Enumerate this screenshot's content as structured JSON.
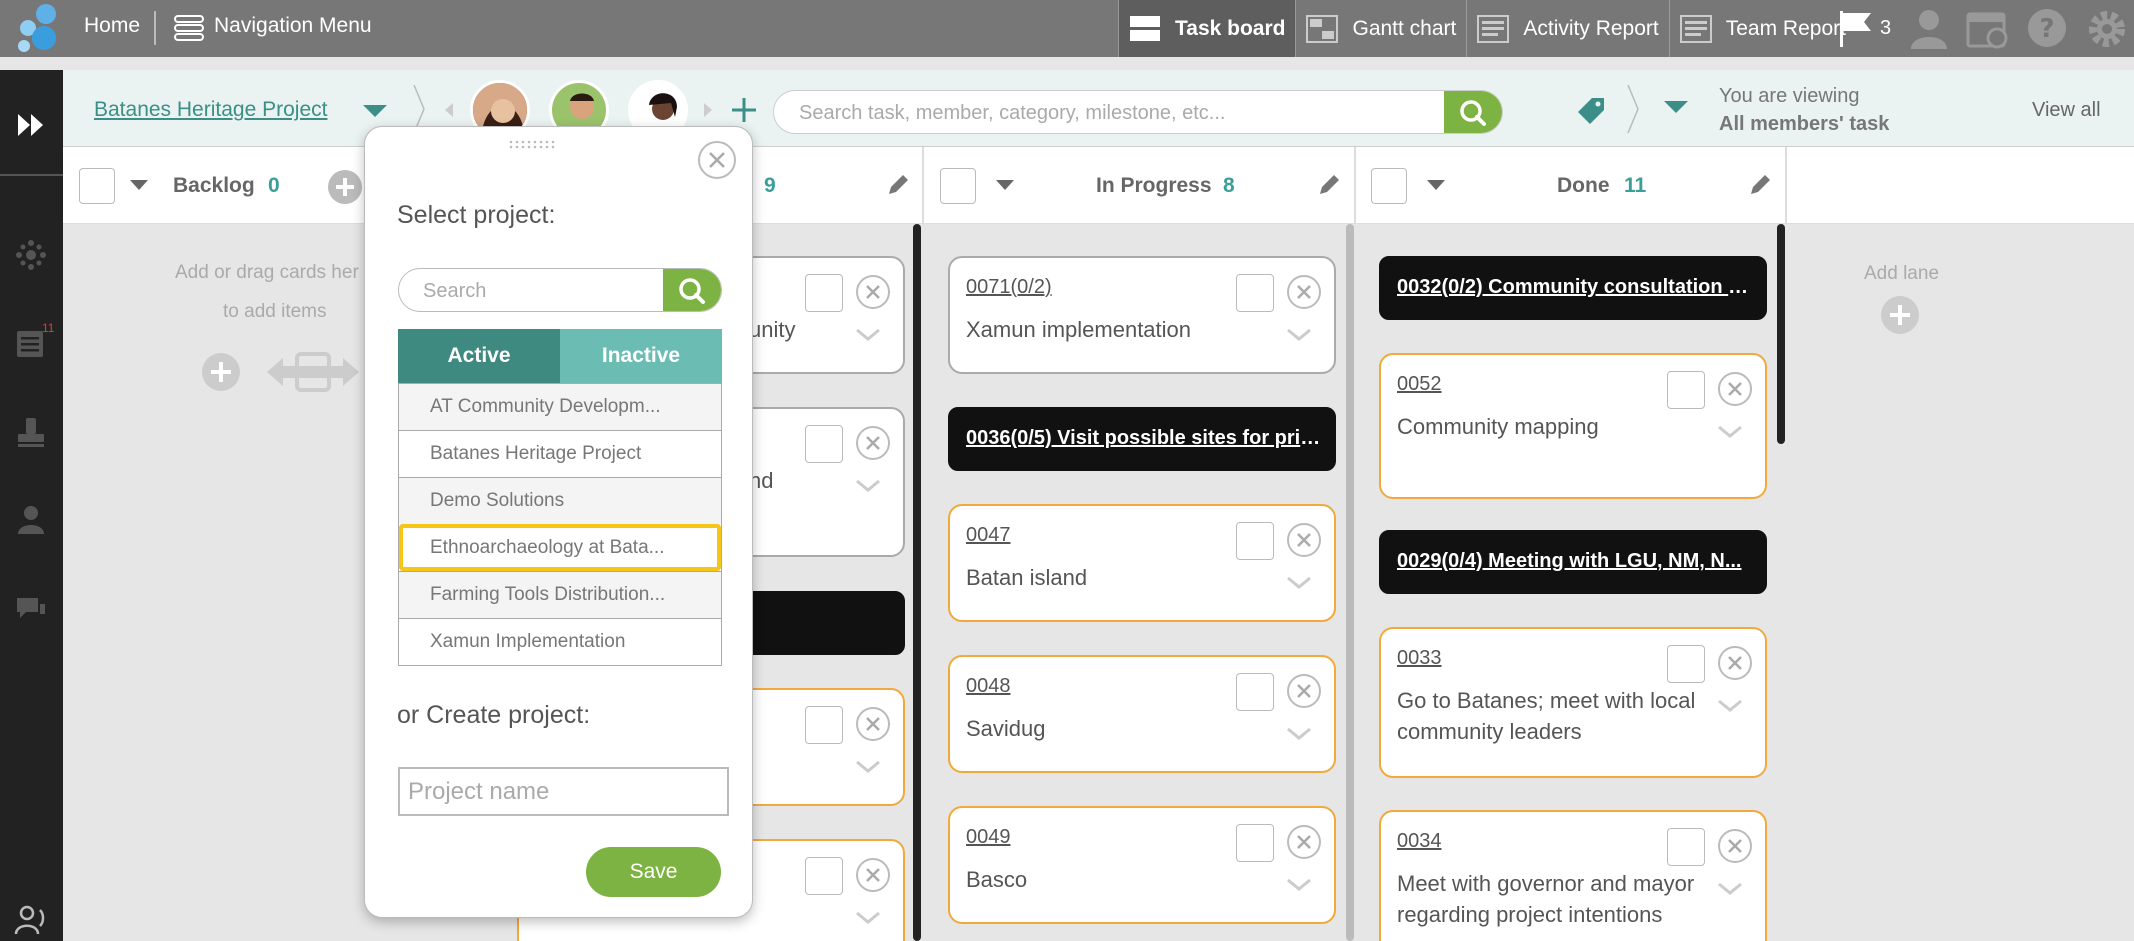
{
  "topbar": {
    "home": "Home",
    "nav_menu": "Navigation Menu",
    "tabs": [
      {
        "label": "Task board",
        "icon": "task-board-icon",
        "active": true
      },
      {
        "label": "Gantt chart",
        "icon": "gantt-chart-icon",
        "active": false
      },
      {
        "label": "Activity Report",
        "icon": "activity-report-icon",
        "active": false
      },
      {
        "label": "Team Report",
        "icon": "team-report-icon",
        "active": false
      }
    ],
    "flag_count": "3"
  },
  "sidebar": {
    "icons": [
      "expand-icon",
      "dashboard-icon",
      "tasks-icon",
      "stamp-icon",
      "user-icon",
      "chat-icon",
      "help-user-icon"
    ],
    "tasks_badge": "11"
  },
  "project_bar": {
    "project_name": "Batanes Heritage Project",
    "search_placeholder": "Search task, member, category, milestone, etc...",
    "viewing_line1": "You are viewing",
    "viewing_line2": "All members' task",
    "view_all": "View all"
  },
  "lanes": [
    {
      "title": "Backlog",
      "count": "0",
      "empty_text_1": "Add or drag cards her",
      "empty_text_2": "to add items"
    },
    {
      "title": "",
      "count": "9"
    },
    {
      "title": "In Progress",
      "count": "8"
    },
    {
      "title": "Done",
      "count": "11"
    }
  ],
  "add_lane": "Add lane",
  "lane2_cards": [
    {
      "fragment": "unity"
    },
    {
      "fragment": "nd"
    }
  ],
  "in_progress_cards": [
    {
      "num": "0071(0/2)",
      "title": "Xamun implementation",
      "style": "gray"
    },
    {
      "num": "",
      "title": "0036(0/5) Visit possible sites for prior...",
      "style": "black"
    },
    {
      "num": "0047",
      "title": "Batan island",
      "style": "orange"
    },
    {
      "num": "0048",
      "title": "Savidug",
      "style": "orange"
    },
    {
      "num": "0049",
      "title": "Basco",
      "style": "orange"
    }
  ],
  "done_cards": [
    {
      "num": "",
      "title": "0032(0/2) Community consultation a...",
      "style": "black"
    },
    {
      "num": "0052",
      "title": "Community mapping",
      "style": "orange"
    },
    {
      "num": "",
      "title": "0029(0/4) Meeting with LGU, NM, N...",
      "style": "black"
    },
    {
      "num": "0033",
      "title": "Go to Batanes; meet with local community leaders",
      "style": "orange"
    },
    {
      "num": "0034",
      "title": "Meet with governor and mayor regarding project intentions",
      "style": "orange"
    }
  ],
  "popup": {
    "select_label": "Select project:",
    "search_placeholder": "Search",
    "tab_active": "Active",
    "tab_inactive": "Inactive",
    "projects": [
      "AT Community Developm...",
      "Batanes Heritage Project",
      "Demo Solutions",
      "Ethnoarchaeology at Bata...",
      "Farming Tools Distribution...",
      "Xamun Implementation"
    ],
    "highlighted_index": 3,
    "create_label": "or Create project:",
    "project_name_placeholder": "Project name",
    "save": "Save"
  },
  "colors": {
    "accent_teal": "#3b8f88",
    "accent_green": "#7cb342",
    "card_orange": "#f2a93b",
    "highlight_yellow": "#f5c518"
  }
}
